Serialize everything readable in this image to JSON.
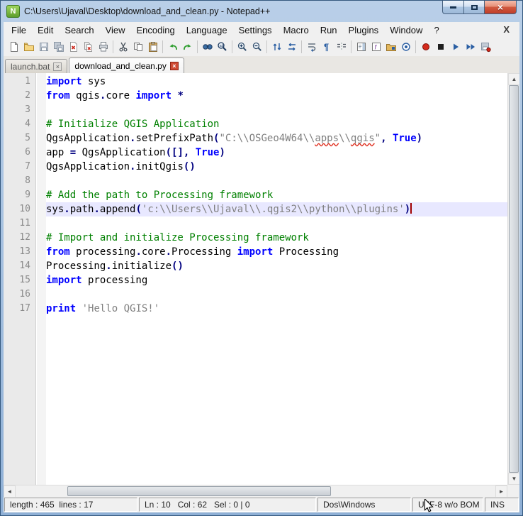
{
  "window": {
    "title": "C:\\Users\\Ujaval\\Desktop\\download_and_clean.py - Notepad++"
  },
  "menu": {
    "items": [
      "File",
      "Edit",
      "Search",
      "View",
      "Encoding",
      "Language",
      "Settings",
      "Macro",
      "Run",
      "Plugins",
      "Window",
      "?"
    ],
    "close_label": "X"
  },
  "toolbar": {
    "icons": [
      "new-file",
      "open-file",
      "save",
      "save-all",
      "close",
      "close-all",
      "print",
      "cut",
      "copy",
      "paste",
      "undo",
      "redo",
      "find",
      "replace",
      "zoom-in",
      "zoom-out",
      "sync-vertical",
      "sync-horizontal",
      "word-wrap",
      "show-all-characters",
      "indent-guide",
      "doc-map",
      "function-list",
      "folder-as-workspace",
      "monitoring",
      "record-macro",
      "stop-macro",
      "play-macro",
      "run-macro-multiple",
      "save-macro"
    ]
  },
  "tabs": [
    {
      "label": "launch.bat",
      "active": false
    },
    {
      "label": "download_and_clean.py",
      "active": true
    }
  ],
  "editor": {
    "current_line": 10,
    "lines": [
      {
        "n": 1,
        "tokens": [
          {
            "c": "k",
            "t": "import"
          },
          {
            "c": "d",
            "t": " sys"
          }
        ]
      },
      {
        "n": 2,
        "tokens": [
          {
            "c": "k",
            "t": "from"
          },
          {
            "c": "d",
            "t": " qgis"
          },
          {
            "c": "o",
            "t": "."
          },
          {
            "c": "d",
            "t": "core "
          },
          {
            "c": "k",
            "t": "import"
          },
          {
            "c": "d",
            "t": " "
          },
          {
            "c": "o",
            "t": "*"
          }
        ]
      },
      {
        "n": 3,
        "tokens": []
      },
      {
        "n": 4,
        "tokens": [
          {
            "c": "c",
            "t": "# Initialize QGIS Application"
          }
        ]
      },
      {
        "n": 5,
        "tokens": [
          {
            "c": "d",
            "t": "QgsApplication"
          },
          {
            "c": "o",
            "t": "."
          },
          {
            "c": "d",
            "t": "setPrefixPath"
          },
          {
            "c": "o",
            "t": "("
          },
          {
            "c": "s",
            "t": "\"C:\\\\OSGeo4W64\\\\"
          },
          {
            "c": "sm",
            "t": "apps"
          },
          {
            "c": "s",
            "t": "\\\\"
          },
          {
            "c": "sm",
            "t": "qgis"
          },
          {
            "c": "s",
            "t": "\""
          },
          {
            "c": "o",
            "t": ","
          },
          {
            "c": "d",
            "t": " "
          },
          {
            "c": "k",
            "t": "True"
          },
          {
            "c": "o",
            "t": ")"
          }
        ]
      },
      {
        "n": 6,
        "tokens": [
          {
            "c": "d",
            "t": "app "
          },
          {
            "c": "o",
            "t": "="
          },
          {
            "c": "d",
            "t": " QgsApplication"
          },
          {
            "c": "o",
            "t": "([],"
          },
          {
            "c": "d",
            "t": " "
          },
          {
            "c": "k",
            "t": "True"
          },
          {
            "c": "o",
            "t": ")"
          }
        ]
      },
      {
        "n": 7,
        "tokens": [
          {
            "c": "d",
            "t": "QgsApplication"
          },
          {
            "c": "o",
            "t": "."
          },
          {
            "c": "d",
            "t": "initQgis"
          },
          {
            "c": "o",
            "t": "()"
          }
        ]
      },
      {
        "n": 8,
        "tokens": []
      },
      {
        "n": 9,
        "tokens": [
          {
            "c": "c",
            "t": "# Add the path to Processing framework"
          }
        ]
      },
      {
        "n": 10,
        "current": true,
        "caret": true,
        "tokens": [
          {
            "c": "d",
            "t": "sys"
          },
          {
            "c": "o",
            "t": "."
          },
          {
            "c": "d",
            "t": "path"
          },
          {
            "c": "o",
            "t": "."
          },
          {
            "c": "d",
            "t": "append"
          },
          {
            "c": "o",
            "t": "("
          },
          {
            "c": "s",
            "t": "'c:\\\\Users\\\\Ujaval\\\\.qgis2\\\\python\\\\plugins'"
          },
          {
            "c": "o",
            "t": ")"
          }
        ]
      },
      {
        "n": 11,
        "tokens": []
      },
      {
        "n": 12,
        "tokens": [
          {
            "c": "c",
            "t": "# Import and initialize Processing framework"
          }
        ]
      },
      {
        "n": 13,
        "tokens": [
          {
            "c": "k",
            "t": "from"
          },
          {
            "c": "d",
            "t": " processing"
          },
          {
            "c": "o",
            "t": "."
          },
          {
            "c": "d",
            "t": "core"
          },
          {
            "c": "o",
            "t": "."
          },
          {
            "c": "d",
            "t": "Processing "
          },
          {
            "c": "k",
            "t": "import"
          },
          {
            "c": "d",
            "t": " Processing"
          }
        ]
      },
      {
        "n": 14,
        "tokens": [
          {
            "c": "d",
            "t": "Processing"
          },
          {
            "c": "o",
            "t": "."
          },
          {
            "c": "d",
            "t": "initialize"
          },
          {
            "c": "o",
            "t": "()"
          }
        ]
      },
      {
        "n": 15,
        "tokens": [
          {
            "c": "k",
            "t": "import"
          },
          {
            "c": "d",
            "t": " processing"
          }
        ]
      },
      {
        "n": 16,
        "tokens": []
      },
      {
        "n": 17,
        "tokens": [
          {
            "c": "k",
            "t": "print"
          },
          {
            "c": "d",
            "t": " "
          },
          {
            "c": "s",
            "t": "'Hello QGIS!'"
          }
        ]
      }
    ]
  },
  "status": {
    "length_lines": "length : 465  lines : 17",
    "position": "Ln : 10   Col : 62   Sel : 0 | 0",
    "eol": "Dos\\Windows",
    "encoding": "UTF-8 w/o BOM",
    "mode": "INS"
  },
  "colors": {
    "keyword": "#0000ff",
    "comment": "#008000",
    "string": "#808080",
    "operator": "#000080",
    "current_line_bg": "#e8e8ff",
    "title_gradient": "#8fb0d6",
    "close_button": "#c03d28"
  }
}
